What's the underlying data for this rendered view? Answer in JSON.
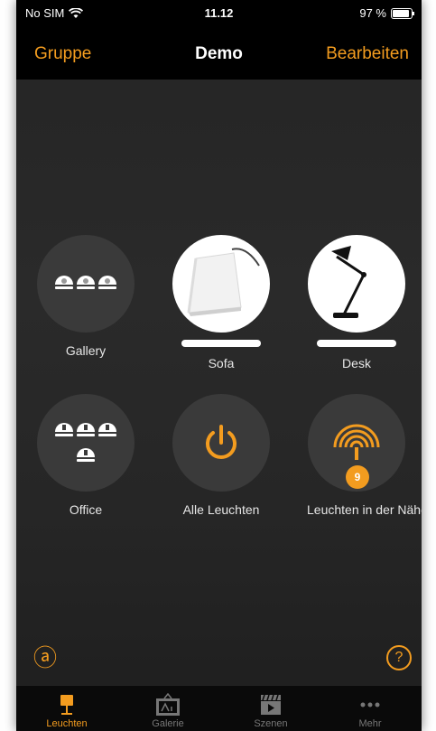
{
  "status": {
    "carrier": "No SIM",
    "time": "11.12",
    "battery": "97 %"
  },
  "nav": {
    "left": "Gruppe",
    "title": "Demo",
    "right": "Bearbeiten"
  },
  "tiles": [
    {
      "label": "Gallery",
      "icon": "three-bulbs-icon"
    },
    {
      "label": "Sofa",
      "icon": "sofa-lamp-image"
    },
    {
      "label": "Desk",
      "icon": "desk-lamp-image"
    },
    {
      "label": "Office",
      "icon": "four-bulbs-icon"
    },
    {
      "label": "Alle Leuchten",
      "icon": "power-icon"
    },
    {
      "label": "Leuchten in der Nähe",
      "icon": "nearby-signal-icon",
      "badge": "9"
    }
  ],
  "corner": {
    "left_icon": "ⓐ",
    "right_icon": "?"
  },
  "tabs": [
    {
      "label": "Leuchten",
      "icon": "lamp-icon",
      "active": true
    },
    {
      "label": "Galerie",
      "icon": "picture-icon"
    },
    {
      "label": "Szenen",
      "icon": "clapper-icon"
    },
    {
      "label": "Mehr",
      "icon": "more-icon"
    }
  ],
  "colors": {
    "accent": "#f39c1f",
    "tile": "#3a3a3a",
    "background": "#262626"
  }
}
